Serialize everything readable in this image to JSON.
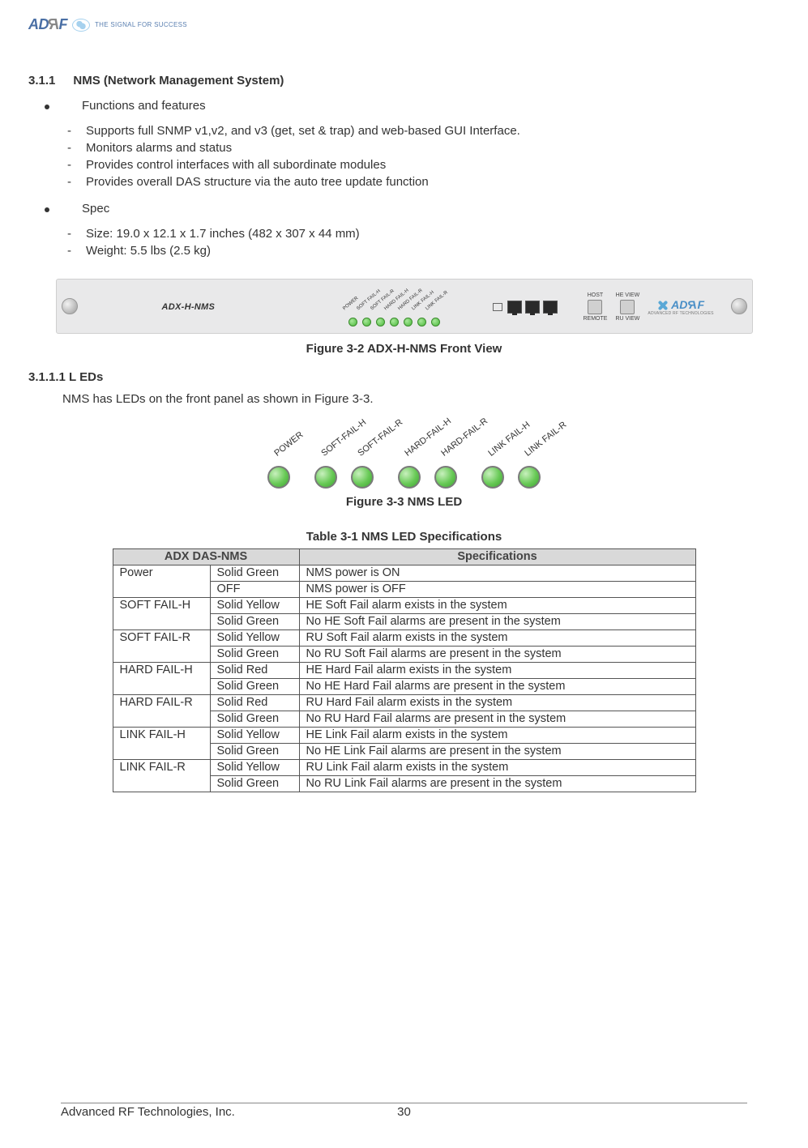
{
  "header": {
    "logo_text": "ADRF",
    "logo_tagline": "THE SIGNAL FOR SUCCESS"
  },
  "section": {
    "number": "3.1.1",
    "title": "NMS (Network Management System)"
  },
  "bullets": {
    "functions_title": "Functions and features",
    "functions": [
      "Supports full SNMP v1,v2, and v3 (get, set & trap) and web-based GUI Interface.",
      "Monitors alarms and status",
      "Provides control interfaces with all subordinate modules",
      "Provides overall DAS structure via the auto tree update function"
    ],
    "spec_title": "Spec",
    "spec": [
      "Size: 19.0 x 12.1 x 1.7 inches (482 x 307 x 44 mm)",
      "Weight: 5.5 lbs (2.5 kg)"
    ]
  },
  "panel": {
    "model": "ADX-H-NMS",
    "mini_leds": [
      "POWER",
      "SOFT FAIL-H",
      "SOFT FAIL-R",
      "HARD FAIL-H",
      "HARD FAIL-R",
      "LINK FAIL-H",
      "LINK FAIL-R"
    ],
    "btn_top": [
      "HOST",
      "HE VIEW"
    ],
    "btn_bottom": [
      "REMOTE",
      "RU VIEW"
    ],
    "logo_text": "ADRF",
    "logo_sub": "ADVANCED RF TECHNOLOGIES"
  },
  "captions": {
    "fig32": "Figure 3-2  ADX-H-NMS Front View",
    "fig33": "Figure 3-3  NMS LED",
    "table31": "Table 3-1    NMS LED Specifications"
  },
  "subsection": {
    "number": "3.1.1.1",
    "title": "L EDs",
    "intro": "NMS has LEDs on the front panel as shown in Figure 3-3."
  },
  "led_figure": {
    "labels": [
      "POWER",
      "SOFT-FAIL-H",
      "SOFT-FAIL-R",
      "HARD-FAIL-H",
      "HARD-FAIL-R",
      "LINK FAIL-H",
      "LINK FAIL-R"
    ]
  },
  "table": {
    "header_left": "ADX DAS-NMS",
    "header_right": "Specifications",
    "rows": [
      {
        "led": "Power",
        "color": "Solid Green",
        "spec": "NMS power is ON",
        "rowspan": 2
      },
      {
        "led": "",
        "color": "OFF",
        "spec": "NMS power is OFF"
      },
      {
        "led": "SOFT FAIL-H",
        "color": "Solid Yellow",
        "spec": "HE Soft Fail alarm exists in the system",
        "rowspan": 2
      },
      {
        "led": "",
        "color": "Solid Green",
        "spec": "No HE Soft Fail alarms are present in the system"
      },
      {
        "led": "SOFT FAIL-R",
        "color": "Solid Yellow",
        "spec": "RU Soft Fail alarm exists in the system",
        "rowspan": 2
      },
      {
        "led": "",
        "color": "Solid Green",
        "spec": "No RU Soft Fail alarms are present in the system"
      },
      {
        "led": "HARD FAIL-H",
        "color": "Solid Red",
        "spec": "HE Hard Fail alarm exists in the system",
        "rowspan": 2
      },
      {
        "led": "",
        "color": "Solid Green",
        "spec": "No HE Hard Fail alarms are present in the system"
      },
      {
        "led": "HARD FAIL-R",
        "color": "Solid Red",
        "spec": "RU Hard Fail alarm exists in the system",
        "rowspan": 2
      },
      {
        "led": "",
        "color": "Solid Green",
        "spec": "No RU Hard Fail alarms are present in the system"
      },
      {
        "led": "LINK FAIL-H",
        "color": "Solid Yellow",
        "spec": "HE Link Fail alarm exists in the system",
        "rowspan": 2
      },
      {
        "led": "",
        "color": "Solid Green",
        "spec": "No HE Link Fail alarms are present in the system"
      },
      {
        "led": "LINK FAIL-R",
        "color": "Solid Yellow",
        "spec": "RU Link Fail alarm exists in the system",
        "rowspan": 2
      },
      {
        "led": "",
        "color": "Solid Green",
        "spec": "No RU Link Fail alarms are present in the system"
      }
    ]
  },
  "footer": {
    "company": "Advanced RF Technologies, Inc.",
    "page": "30"
  }
}
